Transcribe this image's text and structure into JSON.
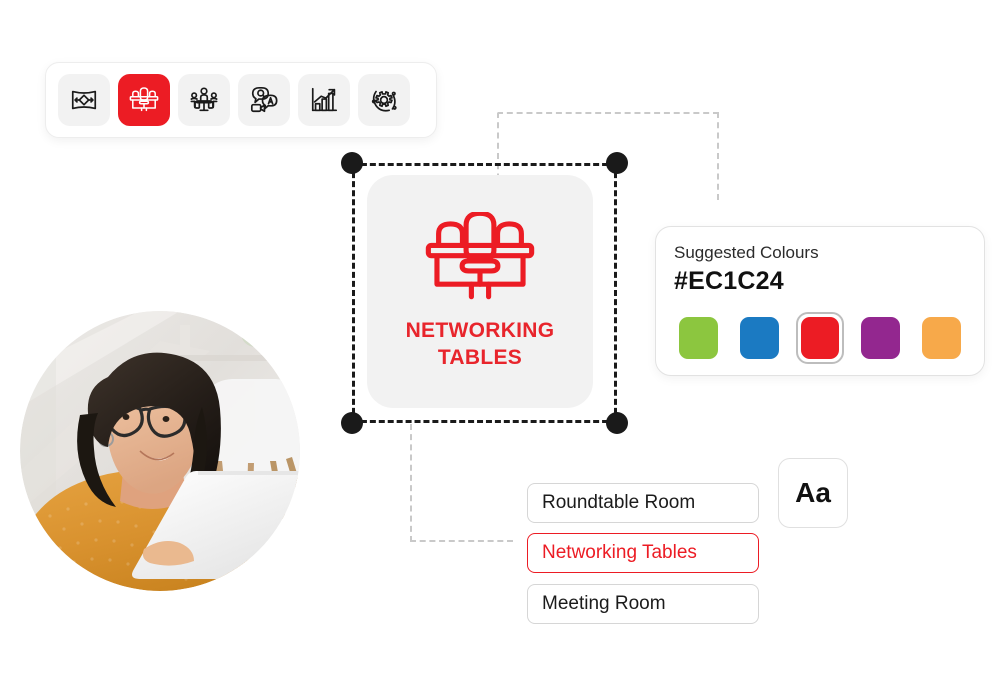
{
  "toolbar": {
    "name": "element-type-toolbar",
    "items": [
      {
        "icon": "stage-perspective-icon",
        "label": "Stage / Perspective",
        "active": false
      },
      {
        "icon": "networking-tables-icon",
        "label": "Networking Tables",
        "active": true
      },
      {
        "icon": "roundtable-meeting-icon",
        "label": "Roundtable Meeting",
        "active": false
      },
      {
        "icon": "video-qa-icon",
        "label": "Video Q&A",
        "active": false
      },
      {
        "icon": "growth-chart-icon",
        "label": "Growth Chart",
        "active": false
      },
      {
        "icon": "settings-orbit-icon",
        "label": "Settings",
        "active": false
      }
    ]
  },
  "canvas": {
    "selected_card": {
      "icon": "networking-tables-icon",
      "label": "NETWORKING\nTABLES",
      "label_line1": "NETWORKING",
      "label_line2": "TABLES",
      "label_color": "#E8252C",
      "background": "#F2F2F2",
      "selected": true
    },
    "handles": [
      "top-left",
      "top-right",
      "bottom-left",
      "bottom-right"
    ]
  },
  "colours_panel": {
    "title": "Suggested Colours",
    "hex": "#EC1C24",
    "swatches": [
      {
        "name": "green",
        "hex": "#8CC63F",
        "selected": false
      },
      {
        "name": "blue",
        "hex": "#1B7AC2",
        "selected": false
      },
      {
        "name": "red",
        "hex": "#EC1C24",
        "selected": true
      },
      {
        "name": "purple",
        "hex": "#93278F",
        "selected": false
      },
      {
        "name": "orange",
        "hex": "#F7A94A",
        "selected": false
      }
    ]
  },
  "name_options": [
    {
      "label": "Roundtable Room",
      "selected": false
    },
    {
      "label": "Networking Tables",
      "selected": true
    },
    {
      "label": "Meeting Room",
      "selected": false
    }
  ],
  "typography_button": {
    "label": "Aa"
  },
  "photo": {
    "name": "user-photo",
    "alt": "Woman with glasses in orange sweater working on a laptop"
  }
}
